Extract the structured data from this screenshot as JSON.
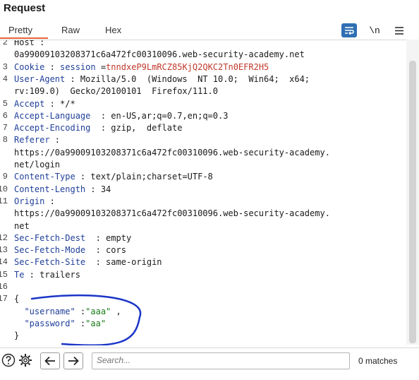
{
  "header": {
    "title": "Request"
  },
  "tabs": [
    {
      "label": "Pretty",
      "active": true
    },
    {
      "label": "Raw",
      "active": false
    },
    {
      "label": "Hex",
      "active": false
    }
  ],
  "toolbar": {
    "wrap_icon": "wrap-lines-icon",
    "newline_label": "\\n",
    "menu_icon": "hamburger-menu-icon"
  },
  "editor": {
    "lines": [
      {
        "num": "2",
        "parts": [
          {
            "t": "Host :"
          }
        ]
      },
      {
        "num": "",
        "parts": [
          {
            "t": "0a99009103208371c6a472fc00310096.web-security-academy.net"
          }
        ]
      },
      {
        "num": "3",
        "parts": [
          {
            "t": "Cookie",
            "c": "k"
          },
          {
            "t": " : "
          },
          {
            "t": "session",
            "c": "k"
          },
          {
            "t": " ="
          },
          {
            "t": "tnndxeP9LmRCZ85KjQ2QKC2Tn0EFR2H5",
            "c": "v-red"
          }
        ]
      },
      {
        "num": "4",
        "parts": [
          {
            "t": "User-Agent",
            "c": "k"
          },
          {
            "t": " : Mozilla/5.0  (Windows  NT 10.0;  Win64;  x64;"
          }
        ]
      },
      {
        "num": "",
        "parts": [
          {
            "t": "rv:109.0)  Gecko/20100101  Firefox/111.0"
          }
        ]
      },
      {
        "num": "5",
        "parts": [
          {
            "t": "Accept",
            "c": "k"
          },
          {
            "t": " : */*"
          }
        ]
      },
      {
        "num": "6",
        "parts": [
          {
            "t": "Accept-Language",
            "c": "k"
          },
          {
            "t": "  : en-US,ar;q=0.7,en;q=0.3"
          }
        ]
      },
      {
        "num": "7",
        "parts": [
          {
            "t": "Accept-Encoding",
            "c": "k"
          },
          {
            "t": "  : gzip,  deflate"
          }
        ]
      },
      {
        "num": "8",
        "parts": [
          {
            "t": "Referer",
            "c": "k"
          },
          {
            "t": " :"
          }
        ]
      },
      {
        "num": "",
        "parts": [
          {
            "t": "https://0a99009103208371c6a472fc00310096.web-security-academy."
          }
        ]
      },
      {
        "num": "",
        "parts": [
          {
            "t": "net/login"
          }
        ]
      },
      {
        "num": "9",
        "parts": [
          {
            "t": "Content-Type",
            "c": "k"
          },
          {
            "t": " : text/plain;charset=UTF-8"
          }
        ]
      },
      {
        "num": "10",
        "parts": [
          {
            "t": "Content-Length",
            "c": "k"
          },
          {
            "t": " : 34"
          }
        ]
      },
      {
        "num": "11",
        "parts": [
          {
            "t": "Origin",
            "c": "k"
          },
          {
            "t": " :"
          }
        ]
      },
      {
        "num": "",
        "parts": [
          {
            "t": "https://0a99009103208371c6a472fc00310096.web-security-academy."
          }
        ]
      },
      {
        "num": "",
        "parts": [
          {
            "t": "net"
          }
        ]
      },
      {
        "num": "12",
        "parts": [
          {
            "t": "Sec-Fetch-Dest",
            "c": "k"
          },
          {
            "t": "  : empty"
          }
        ]
      },
      {
        "num": "13",
        "parts": [
          {
            "t": "Sec-Fetch-Mode",
            "c": "k"
          },
          {
            "t": "  : cors"
          }
        ]
      },
      {
        "num": "14",
        "parts": [
          {
            "t": "Sec-Fetch-Site",
            "c": "k"
          },
          {
            "t": "  : same-origin"
          }
        ]
      },
      {
        "num": "15",
        "parts": [
          {
            "t": "Te",
            "c": "k"
          },
          {
            "t": " : trailers"
          }
        ]
      },
      {
        "num": "16",
        "parts": [
          {
            "t": ""
          }
        ]
      },
      {
        "num": "17",
        "parts": [
          {
            "t": "{"
          }
        ]
      },
      {
        "num": "",
        "parts": [
          {
            "t": "  "
          },
          {
            "t": "\"username\"",
            "c": "q"
          },
          {
            "t": " :"
          },
          {
            "t": "\"aaa\"",
            "c": "s-green"
          },
          {
            "t": " ,"
          }
        ]
      },
      {
        "num": "",
        "parts": [
          {
            "t": "  "
          },
          {
            "t": "\"password\"",
            "c": "q"
          },
          {
            "t": " :"
          },
          {
            "t": "\"aa\"",
            "c": "s-green"
          }
        ]
      },
      {
        "num": "",
        "parts": [
          {
            "t": "}"
          }
        ]
      }
    ]
  },
  "footer": {
    "help_icon": "help-icon",
    "settings_icon": "gear-icon",
    "back_icon": "arrow-left-icon",
    "forward_icon": "arrow-right-icon",
    "search_placeholder": "Search...",
    "matches_label": "0 matches"
  },
  "colors": {
    "accent": "#e8643a",
    "key": "#1f3f9a",
    "cookie_value": "#c0392b",
    "string": "#1a7a1a",
    "annotation": "#1a35c8"
  }
}
